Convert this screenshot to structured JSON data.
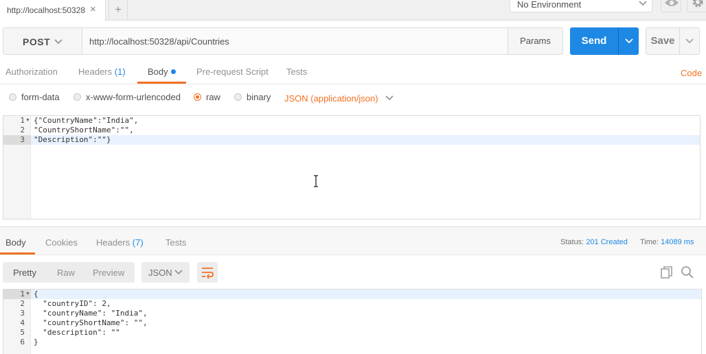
{
  "tab": {
    "title": "http://localhost:50328",
    "close": "×",
    "new": "+"
  },
  "environment": {
    "label": "No Environment"
  },
  "request": {
    "method": "POST",
    "url": "http://localhost:50328/api/Countries",
    "params_label": "Params",
    "send_label": "Send",
    "save_label": "Save",
    "tabs": [
      {
        "label": "Authorization"
      },
      {
        "label": "Headers",
        "count": "(1)"
      },
      {
        "label": "Body"
      },
      {
        "label": "Pre-request Script"
      },
      {
        "label": "Tests"
      }
    ],
    "code_link": "Code",
    "body_types": [
      {
        "label": "form-data",
        "selected": false
      },
      {
        "label": "x-www-form-urlencoded",
        "selected": false
      },
      {
        "label": "raw",
        "selected": true
      },
      {
        "label": "binary",
        "selected": false
      }
    ],
    "content_type": "JSON (application/json)",
    "body_lines": [
      {
        "n": "1",
        "text": "{\"CountryName\":\"India\","
      },
      {
        "n": "2",
        "text": "\"CountryShortName\":\"\","
      },
      {
        "n": "3",
        "text": "\"Description\":\"\"}"
      }
    ]
  },
  "response": {
    "tabs": [
      {
        "label": "Body"
      },
      {
        "label": "Cookies"
      },
      {
        "label": "Headers",
        "count": "(7)"
      },
      {
        "label": "Tests"
      }
    ],
    "status_label": "Status:",
    "status_value": "201 Created",
    "time_label": "Time:",
    "time_value": "14089 ms",
    "views": [
      "Pretty",
      "Raw",
      "Preview"
    ],
    "format": "JSON",
    "body_lines": [
      {
        "n": "1",
        "text": "{"
      },
      {
        "n": "2",
        "text": "  \"countryID\": 2,"
      },
      {
        "n": "3",
        "text": "  \"countryName\": \"India\","
      },
      {
        "n": "4",
        "text": "  \"countryShortName\": \"\","
      },
      {
        "n": "5",
        "text": "  \"description\": \"\""
      },
      {
        "n": "6",
        "text": "}"
      }
    ]
  },
  "colors": {
    "accent": "#f47023",
    "primary": "#1e88e5"
  },
  "icons": [
    "chevron-down-icon",
    "eye-icon",
    "gear-icon",
    "wrap-icon",
    "copy-icon",
    "search-icon",
    "text-cursor-icon"
  ]
}
